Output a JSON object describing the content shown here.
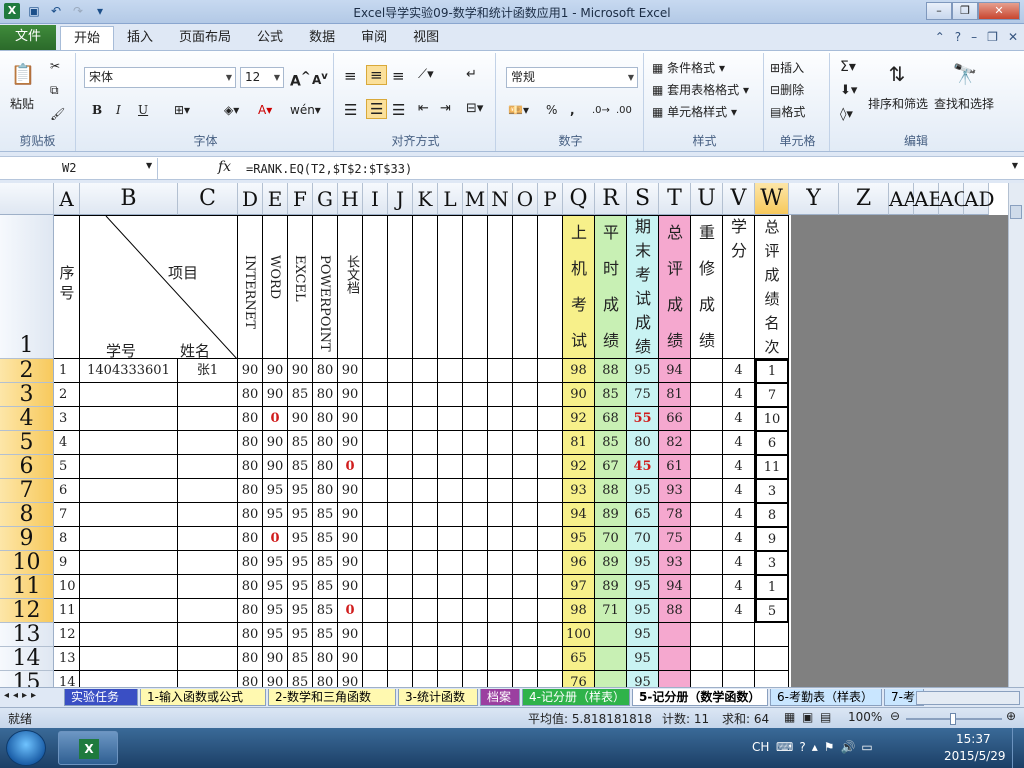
{
  "window": {
    "title": "Excel导学实验09-数学和统计函数应用1 - Microsoft Excel"
  },
  "menu": {
    "file": "文件",
    "tabs": [
      "开始",
      "插入",
      "页面布局",
      "公式",
      "数据",
      "审阅",
      "视图"
    ],
    "active_tab": "开始"
  },
  "ribbon": {
    "clipboard": {
      "paste": "粘贴",
      "label": "剪贴板"
    },
    "font": {
      "name": "宋体",
      "size": "12",
      "bold": "B",
      "italic": "I",
      "underline": "U",
      "label": "字体"
    },
    "alignment": {
      "label": "对齐方式"
    },
    "number": {
      "format": "常规",
      "percent": "%",
      "comma": ",",
      "label": "数字"
    },
    "styles": {
      "cond": "条件格式",
      "table": "套用表格格式",
      "cell": "单元格样式",
      "label": "样式"
    },
    "cells": {
      "insert": "插入",
      "delete": "删除",
      "format": "格式",
      "label": "单元格"
    },
    "editing": {
      "sort": "排序和筛选",
      "find": "查找和选择",
      "label": "编辑"
    }
  },
  "formula_bar": {
    "name_box": "W2",
    "fx": "fx",
    "formula": "=RANK.EQ(T2,$T$2:$T$33)"
  },
  "columns": [
    "A",
    "B",
    "C",
    "D",
    "E",
    "F",
    "G",
    "H",
    "I",
    "J",
    "K",
    "L",
    "M",
    "N",
    "O",
    "P",
    "Q",
    "R",
    "S",
    "T",
    "U",
    "V",
    "W",
    "Y",
    "Z",
    "AA",
    "AE",
    "AC",
    "AD"
  ],
  "rows": [
    "1",
    "2",
    "3",
    "4",
    "5",
    "6",
    "7",
    "8",
    "9",
    "10",
    "11",
    "12",
    "13",
    "14",
    "15"
  ],
  "header": {
    "seq": "序号",
    "item": "项目",
    "id": "学号",
    "name": "姓名",
    "internet": "INTERNET",
    "word": "WORD",
    "excel": "EXCEL",
    "ppt": "POWERPOINT",
    "longdoc": "长文档",
    "q": [
      "上",
      "机",
      "考",
      "试"
    ],
    "r": [
      "平",
      "时",
      "成",
      "绩"
    ],
    "s": [
      "期",
      "末",
      "考",
      "试",
      "成",
      "绩"
    ],
    "t": [
      "总",
      "评",
      "成",
      "绩"
    ],
    "u": [
      "重",
      "修",
      "成",
      "绩"
    ],
    "v": [
      "学",
      "分"
    ],
    "w": [
      "总",
      "评",
      "成",
      "绩",
      "名",
      "次"
    ]
  },
  "data_rows": [
    {
      "a": "1",
      "b": "1404333601",
      "c": "张1",
      "d": "90",
      "e": "90",
      "f": "90",
      "g": "80",
      "h": "90",
      "q": "98",
      "r": "88",
      "s": "95",
      "t": "94",
      "v": "4",
      "w": "1"
    },
    {
      "a": "2",
      "b": "",
      "c": "",
      "d": "80",
      "e": "90",
      "f": "85",
      "g": "80",
      "h": "90",
      "q": "90",
      "r": "85",
      "s": "75",
      "t": "81",
      "v": "4",
      "w": "7"
    },
    {
      "a": "3",
      "b": "",
      "c": "",
      "d": "80",
      "e": "0",
      "f": "90",
      "g": "80",
      "h": "90",
      "q": "92",
      "r": "68",
      "s": "55",
      "t": "66",
      "v": "4",
      "w": "10"
    },
    {
      "a": "4",
      "b": "",
      "c": "",
      "d": "80",
      "e": "90",
      "f": "85",
      "g": "80",
      "h": "90",
      "q": "81",
      "r": "85",
      "s": "80",
      "t": "82",
      "v": "4",
      "w": "6"
    },
    {
      "a": "5",
      "b": "",
      "c": "",
      "d": "80",
      "e": "90",
      "f": "85",
      "g": "80",
      "h": "0",
      "q": "92",
      "r": "67",
      "s": "45",
      "t": "61",
      "v": "4",
      "w": "11"
    },
    {
      "a": "6",
      "b": "",
      "c": "",
      "d": "80",
      "e": "95",
      "f": "95",
      "g": "80",
      "h": "90",
      "q": "93",
      "r": "88",
      "s": "95",
      "t": "93",
      "v": "4",
      "w": "3"
    },
    {
      "a": "7",
      "b": "",
      "c": "",
      "d": "80",
      "e": "95",
      "f": "95",
      "g": "85",
      "h": "90",
      "q": "94",
      "r": "89",
      "s": "65",
      "t": "78",
      "v": "4",
      "w": "8"
    },
    {
      "a": "8",
      "b": "",
      "c": "",
      "d": "80",
      "e": "0",
      "f": "95",
      "g": "85",
      "h": "90",
      "q": "95",
      "r": "70",
      "s": "70",
      "t": "75",
      "v": "4",
      "w": "9"
    },
    {
      "a": "9",
      "b": "",
      "c": "",
      "d": "80",
      "e": "95",
      "f": "95",
      "g": "85",
      "h": "90",
      "q": "96",
      "r": "89",
      "s": "95",
      "t": "93",
      "v": "4",
      "w": "3"
    },
    {
      "a": "10",
      "b": "",
      "c": "",
      "d": "80",
      "e": "95",
      "f": "95",
      "g": "85",
      "h": "90",
      "q": "97",
      "r": "89",
      "s": "95",
      "t": "94",
      "v": "4",
      "w": "1"
    },
    {
      "a": "11",
      "b": "",
      "c": "",
      "d": "80",
      "e": "95",
      "f": "95",
      "g": "85",
      "h": "0",
      "q": "98",
      "r": "71",
      "s": "95",
      "t": "88",
      "v": "4",
      "w": "5"
    },
    {
      "a": "12",
      "b": "",
      "c": "",
      "d": "80",
      "e": "95",
      "f": "95",
      "g": "85",
      "h": "90",
      "q": "100",
      "r": "",
      "s": "95",
      "t": "",
      "v": "",
      "w": ""
    },
    {
      "a": "13",
      "b": "",
      "c": "",
      "d": "80",
      "e": "90",
      "f": "85",
      "g": "80",
      "h": "90",
      "q": "65",
      "r": "",
      "s": "95",
      "t": "",
      "v": "",
      "w": ""
    },
    {
      "a": "14",
      "b": "",
      "c": "",
      "d": "80",
      "e": "90",
      "f": "85",
      "g": "80",
      "h": "90",
      "q": "76",
      "r": "",
      "s": "95",
      "t": "",
      "v": "",
      "w": ""
    }
  ],
  "colors": {
    "q_fill": "#f7f08a",
    "r_fill": "#c8f0b4",
    "s_fill": "#c9f3f3",
    "t_fill": "#f5a8cf",
    "w_fill": "#fdf6cf",
    "file_tab": "#2e7a2f",
    "red_text": "#d01c1c"
  },
  "sheet_tabs": [
    "实验任务",
    "1-输入函数或公式",
    "2-数学和三角函数",
    "3-统计函数",
    "档案",
    "4-记分册（样表）",
    "5-记分册（数学函数）",
    "6-考勤表（样表）",
    "7-考"
  ],
  "active_sheet": "5-记分册（数学函数）",
  "status": {
    "ready": "就绪",
    "average": "平均值: 5.818181818",
    "count": "计数: 11",
    "sum": "求和: 64",
    "zoom": "100%"
  },
  "taskbar": {
    "lang": "CH",
    "time": "15:37",
    "date": "2015/5/29"
  }
}
